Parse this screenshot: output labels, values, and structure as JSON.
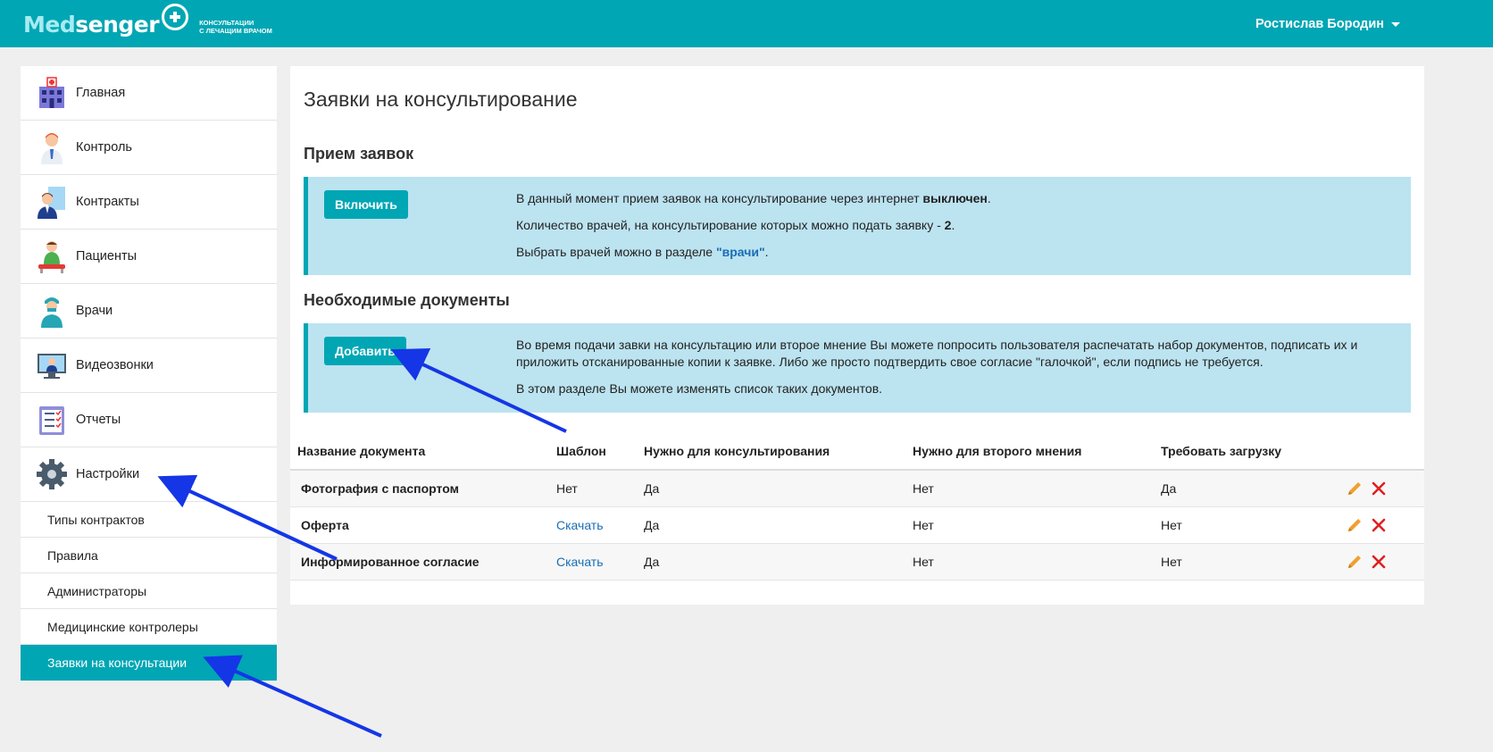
{
  "header": {
    "logo_main_dark": "Med",
    "logo_main_light": "senger",
    "logo_sub_line1": "консультации",
    "logo_sub_line2": "с лечащим врачом",
    "user_name": "Ростислав Бородин"
  },
  "sidebar": {
    "items": [
      {
        "label": "Главная",
        "icon": "hospital-icon"
      },
      {
        "label": "Контроль",
        "icon": "doctor-icon"
      },
      {
        "label": "Контракты",
        "icon": "contract-icon"
      },
      {
        "label": "Пациенты",
        "icon": "patient-icon"
      },
      {
        "label": "Врачи",
        "icon": "physician-icon"
      },
      {
        "label": "Видеозвонки",
        "icon": "video-call-icon"
      },
      {
        "label": "Отчеты",
        "icon": "report-icon"
      },
      {
        "label": "Настройки",
        "icon": "gear-icon"
      }
    ],
    "sub_items": [
      {
        "label": "Типы контрактов"
      },
      {
        "label": "Правила"
      },
      {
        "label": "Администраторы"
      },
      {
        "label": "Медицинские контролеры"
      },
      {
        "label": "Заявки на консультации",
        "active": true
      }
    ]
  },
  "main": {
    "title": "Заявки на консультирование",
    "intake": {
      "heading": "Прием заявок",
      "button": "Включить",
      "line1_prefix": "В данный момент прием заявок на консультирование через интернет ",
      "line1_bold": "выключен",
      "line1_suffix": ".",
      "line2_prefix": "Количество врачей, на консультирование которых можно подать заявку - ",
      "line2_bold": "2",
      "line2_suffix": ".",
      "line3_prefix": "Выбрать врачей можно в разделе ",
      "line3_link": "\"врачи\"",
      "line3_suffix": "."
    },
    "documents": {
      "heading": "Необходимые документы",
      "button": "Добавить",
      "para1_line1": "Во время подачи завки на консультацию или второе мнение Вы можете попросить пользователя распечатать набор документов, подписать их и",
      "para1_line2": "приложить отсканированные копии к заявке. Либо же просто подтвердить свое согласие \"галочкой\", если подпись не требуется.",
      "para2": "В этом разделе Вы можете изменять список таких документов."
    },
    "table": {
      "columns": [
        "Название документа",
        "Шаблон",
        "Нужно для консультирования",
        "Нужно для второго мнения",
        "Требовать загрузку"
      ],
      "rows": [
        {
          "name": "Фотография с паспортом",
          "template": "Нет",
          "template_link": false,
          "consult": "Да",
          "second": "Нет",
          "upload": "Да"
        },
        {
          "name": "Оферта",
          "template": "Скачать",
          "template_link": true,
          "consult": "Да",
          "second": "Нет",
          "upload": "Нет"
        },
        {
          "name": "Информированное согласие",
          "template": "Скачать",
          "template_link": true,
          "consult": "Да",
          "second": "Нет",
          "upload": "Нет"
        }
      ]
    }
  },
  "colors": {
    "accent": "#00a6b4",
    "info_bg": "#bce3f0",
    "link": "#1a6eb5",
    "arrow": "#1436e6",
    "edit": "#f0a030",
    "delete": "#e02020"
  }
}
